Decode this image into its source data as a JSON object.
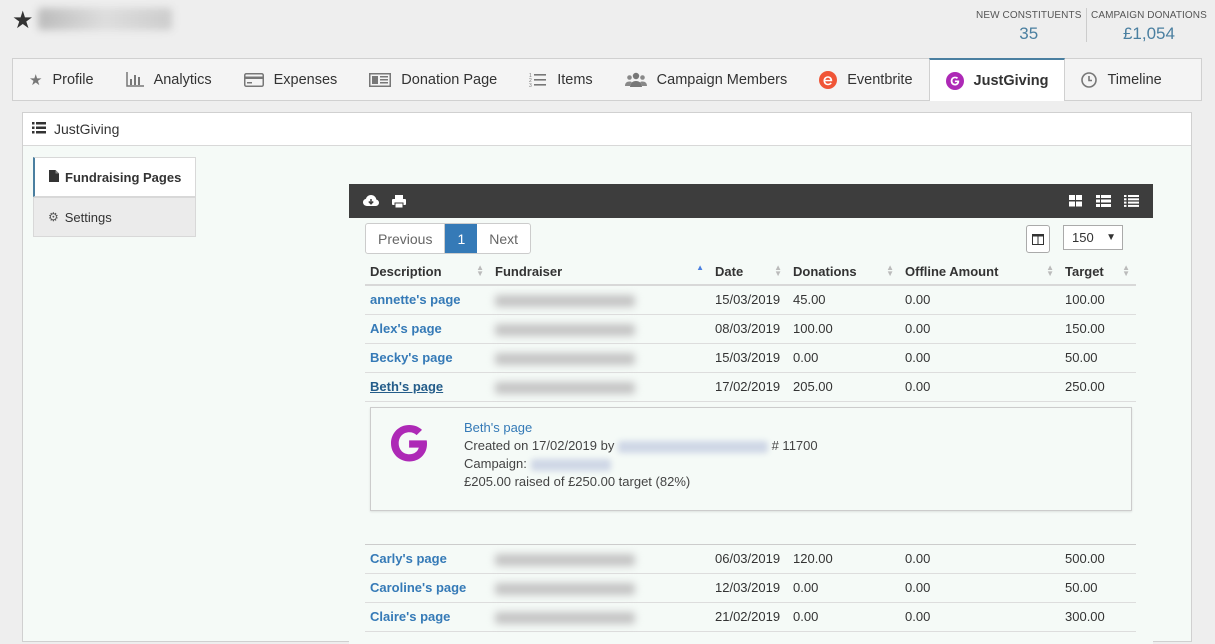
{
  "header": {
    "stats": [
      {
        "label": "NEW CONSTITUENTS",
        "value": "35"
      },
      {
        "label": "CAMPAIGN DONATIONS",
        "value": "£1,054"
      }
    ]
  },
  "tabs": [
    {
      "label": "Profile",
      "icon": "star-icon"
    },
    {
      "label": "Analytics",
      "icon": "bar-chart-icon"
    },
    {
      "label": "Expenses",
      "icon": "credit-card-icon"
    },
    {
      "label": "Donation Page",
      "icon": "newspaper-icon"
    },
    {
      "label": "Items",
      "icon": "list-ol-icon"
    },
    {
      "label": "Campaign Members",
      "icon": "users-icon"
    },
    {
      "label": "Eventbrite",
      "icon": "eventbrite-icon"
    },
    {
      "label": "JustGiving",
      "icon": "justgiving-icon",
      "active": true
    },
    {
      "label": "Timeline",
      "icon": "clock-icon"
    }
  ],
  "panel": {
    "title": "JustGiving",
    "side": [
      {
        "label": "Fundraising Pages",
        "active": true
      },
      {
        "label": "Settings"
      }
    ]
  },
  "grid": {
    "pager": {
      "prev": "Previous",
      "page": "1",
      "next": "Next"
    },
    "per_page": "150",
    "columns": [
      "Description",
      "Fundraiser",
      "Date",
      "Donations",
      "Offline Amount",
      "Target"
    ],
    "rows_top": [
      {
        "desc": "annette's page",
        "date": "15/03/2019",
        "donations": "45.00",
        "offline": "0.00",
        "target": "100.00"
      },
      {
        "desc": "Alex's page",
        "date": "08/03/2019",
        "donations": "100.00",
        "offline": "0.00",
        "target": "150.00"
      },
      {
        "desc": "Becky's page",
        "date": "15/03/2019",
        "donations": "0.00",
        "offline": "0.00",
        "target": "50.00"
      },
      {
        "desc": "Beth's page",
        "date": "17/02/2019",
        "donations": "205.00",
        "offline": "0.00",
        "target": "250.00"
      }
    ],
    "detail": {
      "title": "Beth's page",
      "created": "Created on 17/02/2019 by",
      "id": "# 11700",
      "campaign": "Campaign:",
      "raised": "£205.00 raised of £250.00 target (82%)"
    },
    "rows_bottom": [
      {
        "desc": "Carly's page",
        "date": "06/03/2019",
        "donations": "120.00",
        "offline": "0.00",
        "target": "500.00"
      },
      {
        "desc": "Caroline's page",
        "date": "12/03/2019",
        "donations": "0.00",
        "offline": "0.00",
        "target": "50.00"
      },
      {
        "desc": "Claire's page",
        "date": "21/02/2019",
        "donations": "0.00",
        "offline": "0.00",
        "target": "300.00"
      }
    ]
  },
  "colors": {
    "accent": "#4a7fa0",
    "link": "#357ab7",
    "justgiving": "#ad29b6",
    "eventbrite": "#f05537"
  }
}
